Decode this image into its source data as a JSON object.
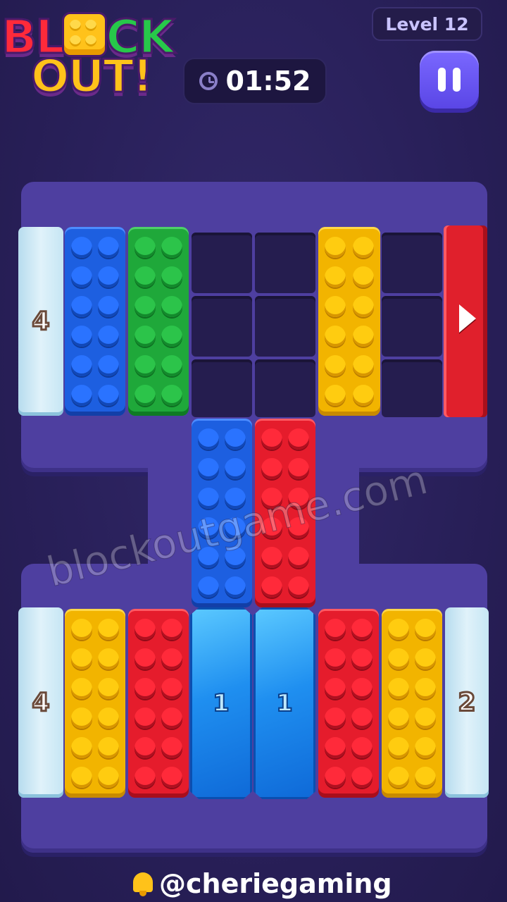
{
  "header": {
    "logo": {
      "line1": [
        "BL",
        "CK"
      ],
      "line2": "OUT!"
    },
    "level_label": "Level 12",
    "timer": "01:52",
    "pause_icon": "pause-icon",
    "clock_icon": "clock-icon"
  },
  "board": {
    "walls": {
      "top_left_count": "4",
      "bottom_left_count": "4",
      "bottom_right_count": "2"
    },
    "exit_arrow_icon": "arrow-right-icon",
    "gems": [
      {
        "count": "1"
      },
      {
        "count": "1"
      }
    ],
    "block_colors": {
      "blue": "#1d5fe0",
      "green": "#1fa83a",
      "yellow": "#f2b400",
      "red": "#e51c2c"
    }
  },
  "watermark": "blockoutgame.com",
  "footer": {
    "handle": "@cheriegaming",
    "bell_icon": "bell-icon"
  }
}
